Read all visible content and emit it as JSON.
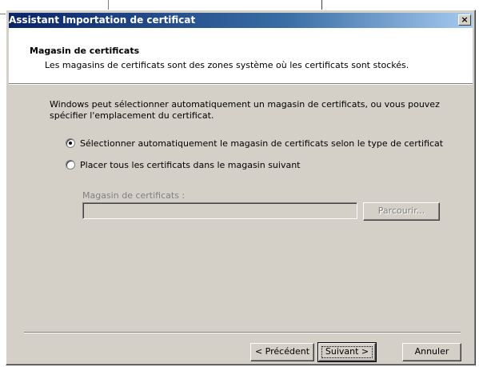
{
  "window": {
    "title": "Assistant Importation de certificat",
    "close_glyph": "×",
    "title_gradient": [
      "#0a246a",
      "#a6caf0"
    ]
  },
  "header": {
    "title": "Magasin de certificats",
    "subtitle": "Les magasins de certificats sont des zones système où les certificats sont stockés."
  },
  "body": {
    "intro": "Windows peut sélectionner automatiquement un magasin de certificats, ou vous pouvez spécifier l'emplacement du certificat.",
    "options": [
      {
        "label": "Sélectionner automatiquement le magasin de certificats selon le type de certificat",
        "checked": true
      },
      {
        "label": "Placer tous les certificats dans le magasin suivant",
        "checked": false
      }
    ],
    "store_label": "Magasin de certificats :",
    "store_value": "",
    "browse_label": "Parcourir..."
  },
  "footer": {
    "back_label": "< Précédent",
    "next_label": "Suivant >",
    "cancel_label": "Annuler"
  }
}
